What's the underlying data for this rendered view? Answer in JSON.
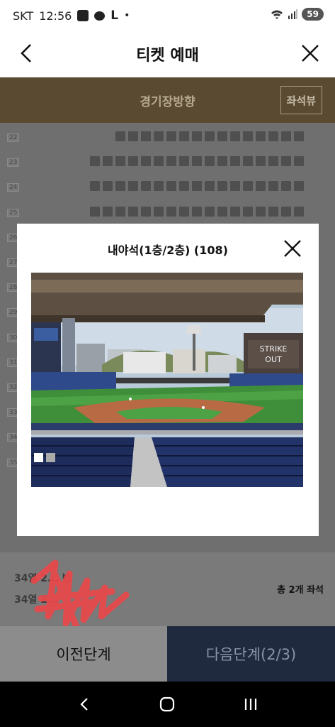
{
  "status_bar": {
    "carrier": "SKT",
    "time": "12:56",
    "l_glyph": "L",
    "dot": "•",
    "battery": "59"
  },
  "header": {
    "title": "티켓 예매"
  },
  "stadium_bar": {
    "label": "경기장방향",
    "seat_view_button": "좌석뷰"
  },
  "seat_rows": [
    "22",
    "23",
    "24",
    "25",
    "26",
    "27",
    "28",
    "29",
    "30",
    "31",
    "32",
    "33",
    "34",
    "35"
  ],
  "summary": {
    "line1": "34열 2... 번",
    "line2": "34열 2...",
    "total": "총 2개 좌석"
  },
  "buttons": {
    "prev": "이전단계",
    "next": "다음단계(2/3)"
  },
  "modal": {
    "title": "내야석(1층/2층) (108)",
    "scoreboard_text": "STRIKE OUT"
  }
}
